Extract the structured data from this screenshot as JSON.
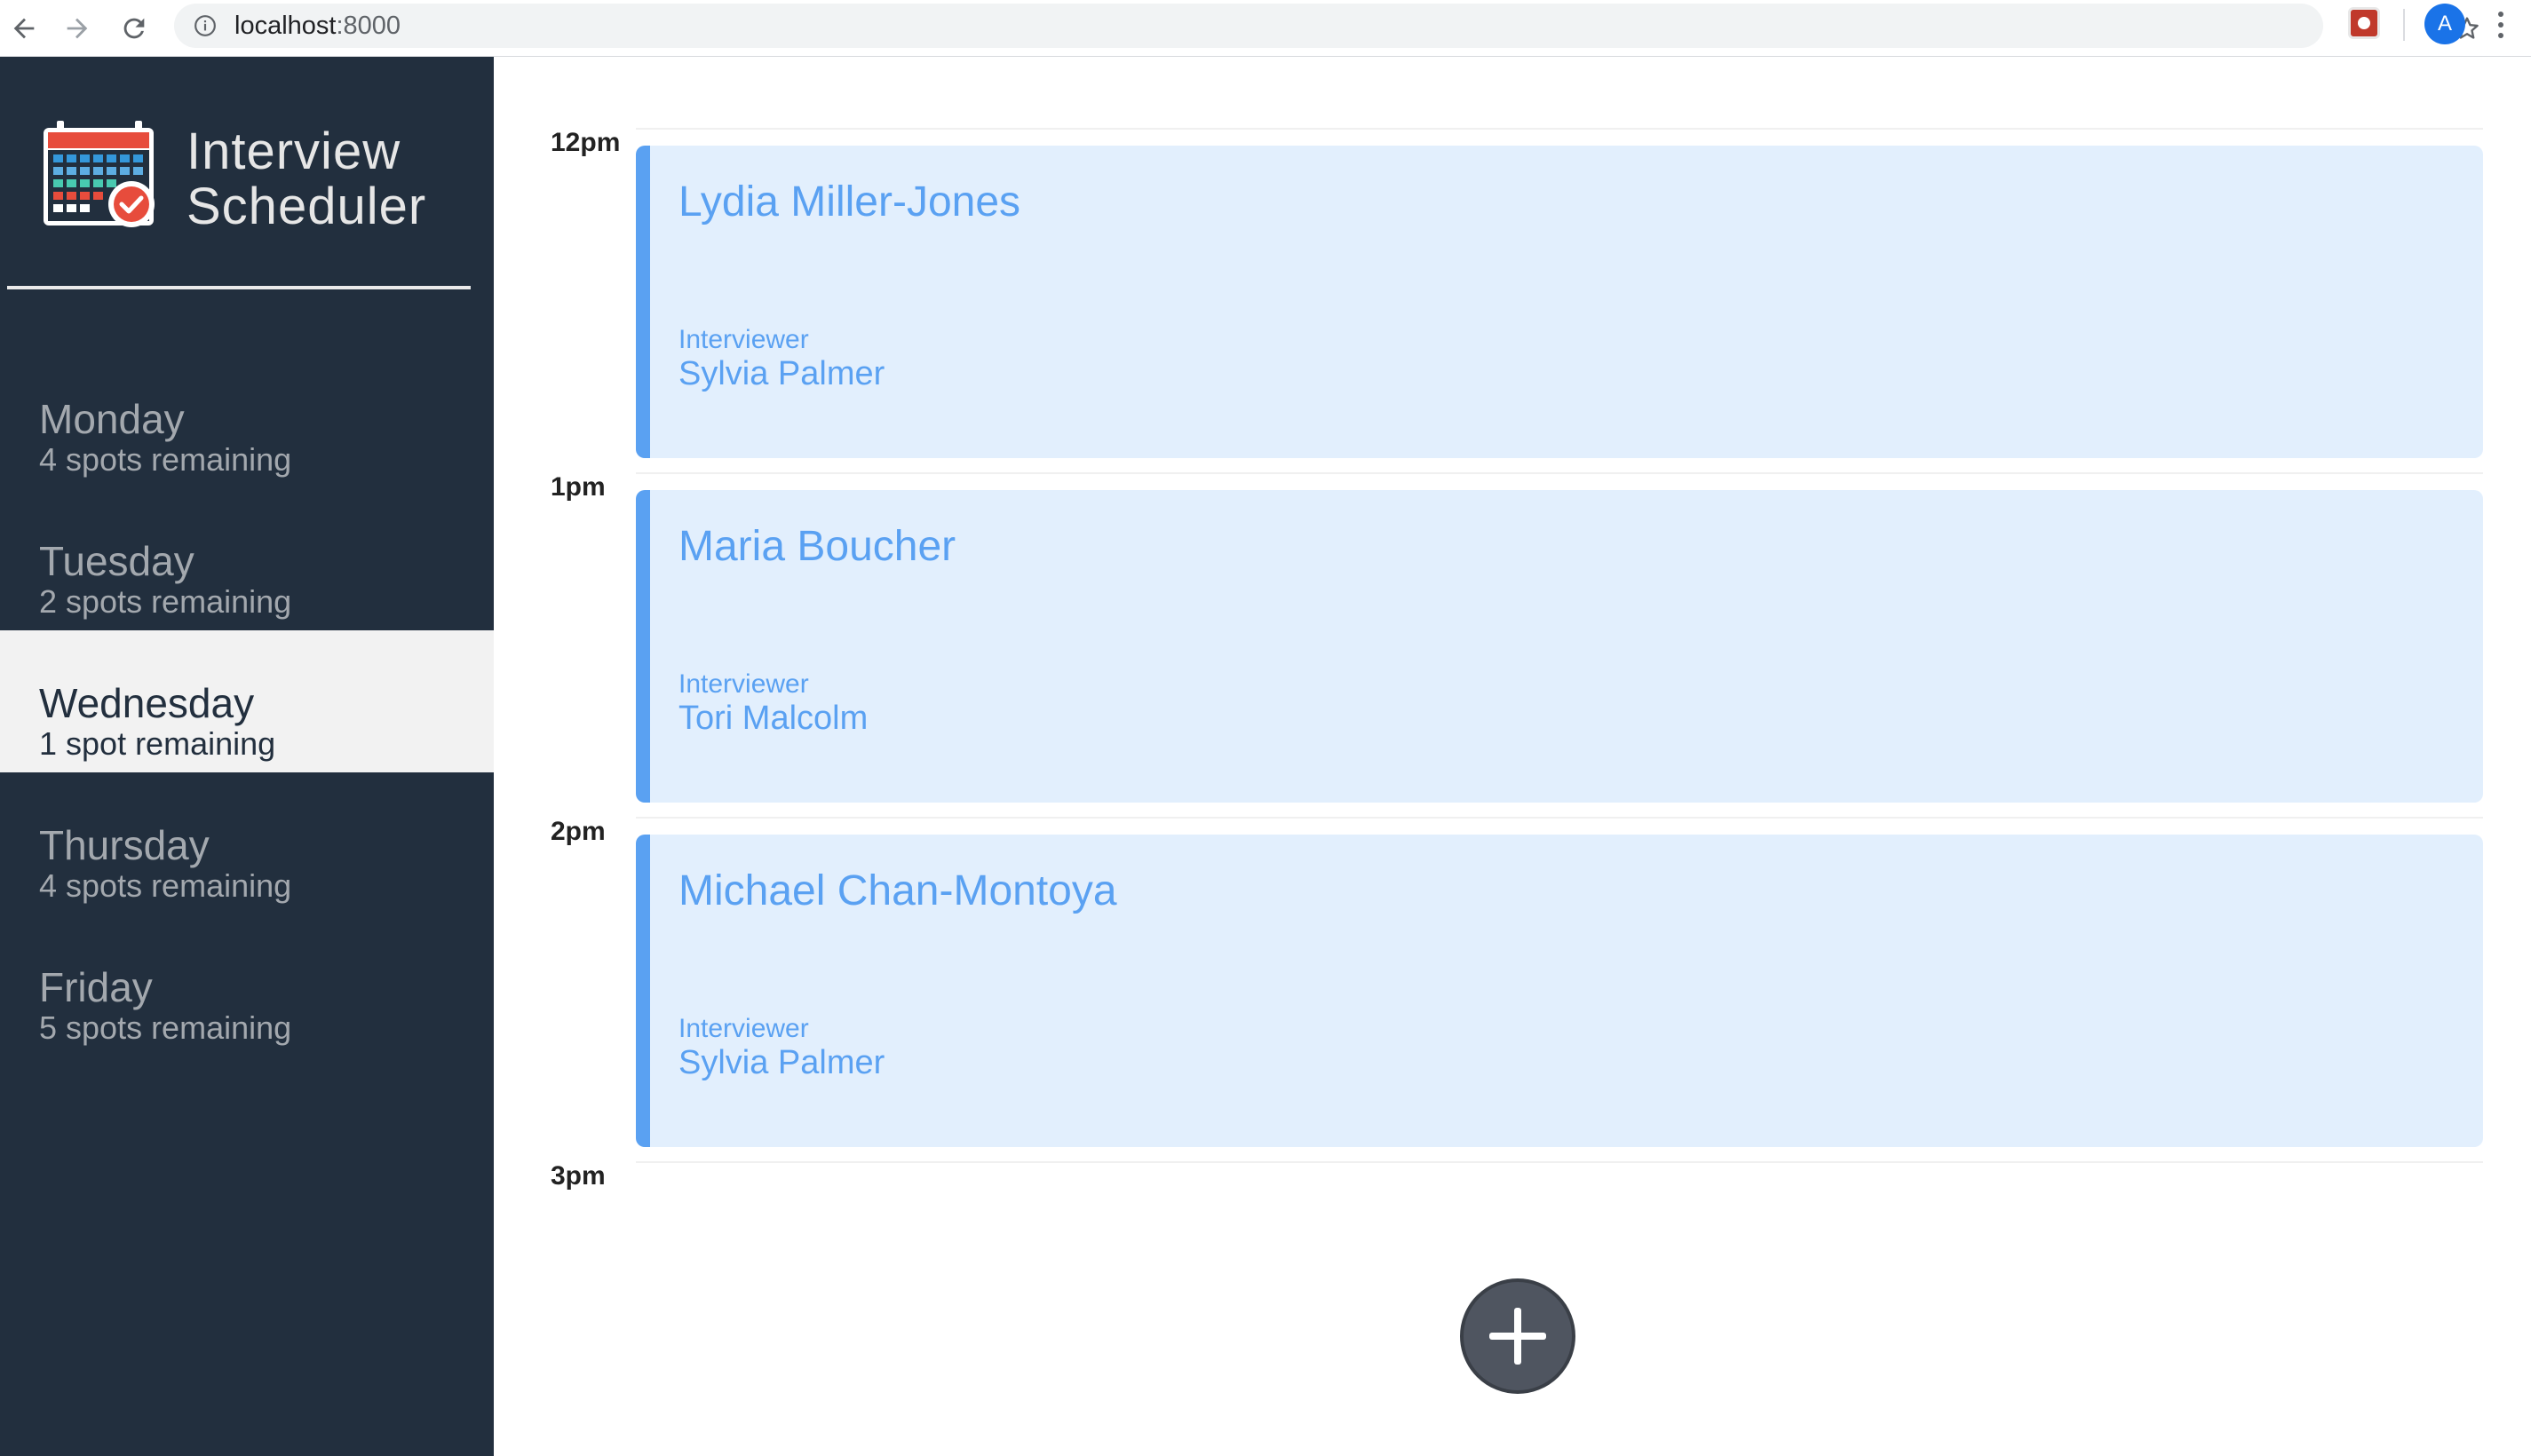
{
  "browser": {
    "url_host": "localhost",
    "url_port": ":8000",
    "avatar_initial": "A",
    "icons": [
      "back-arrow-icon",
      "forward-arrow-icon",
      "reload-icon",
      "info-icon",
      "star-icon",
      "extension-icon",
      "kebab-menu-icon"
    ]
  },
  "sidebar": {
    "brand": {
      "line1": "Interview",
      "line2": "Scheduler",
      "logo_icon": "calendar-check-icon"
    },
    "days": [
      {
        "name": "Monday",
        "spots": "4 spots remaining",
        "selected": false
      },
      {
        "name": "Tuesday",
        "spots": "2 spots remaining",
        "selected": false
      },
      {
        "name": "Wednesday",
        "spots": "1 spot remaining",
        "selected": true
      },
      {
        "name": "Thursday",
        "spots": "4 spots remaining",
        "selected": false
      },
      {
        "name": "Friday",
        "spots": "5 spots remaining",
        "selected": false
      }
    ]
  },
  "schedule": {
    "times": [
      "12pm",
      "1pm",
      "2pm",
      "3pm"
    ],
    "appointments": [
      {
        "student": "Lydia Miller-Jones",
        "interviewer_label": "Interviewer",
        "interviewer": "Sylvia Palmer"
      },
      {
        "student": "Maria Boucher",
        "interviewer_label": "Interviewer",
        "interviewer": "Tori Malcolm"
      },
      {
        "student": "Michael Chan-Montoya",
        "interviewer_label": "Interviewer",
        "interviewer": "Sylvia Palmer"
      }
    ],
    "add_icon": "plus-icon"
  },
  "colors": {
    "sidebar_bg": "#222f3e",
    "selected_bg": "#f2f2f2",
    "appointment_bg": "#e2effd",
    "accent": "#5aa1f2",
    "add_button": "#4f5560"
  }
}
